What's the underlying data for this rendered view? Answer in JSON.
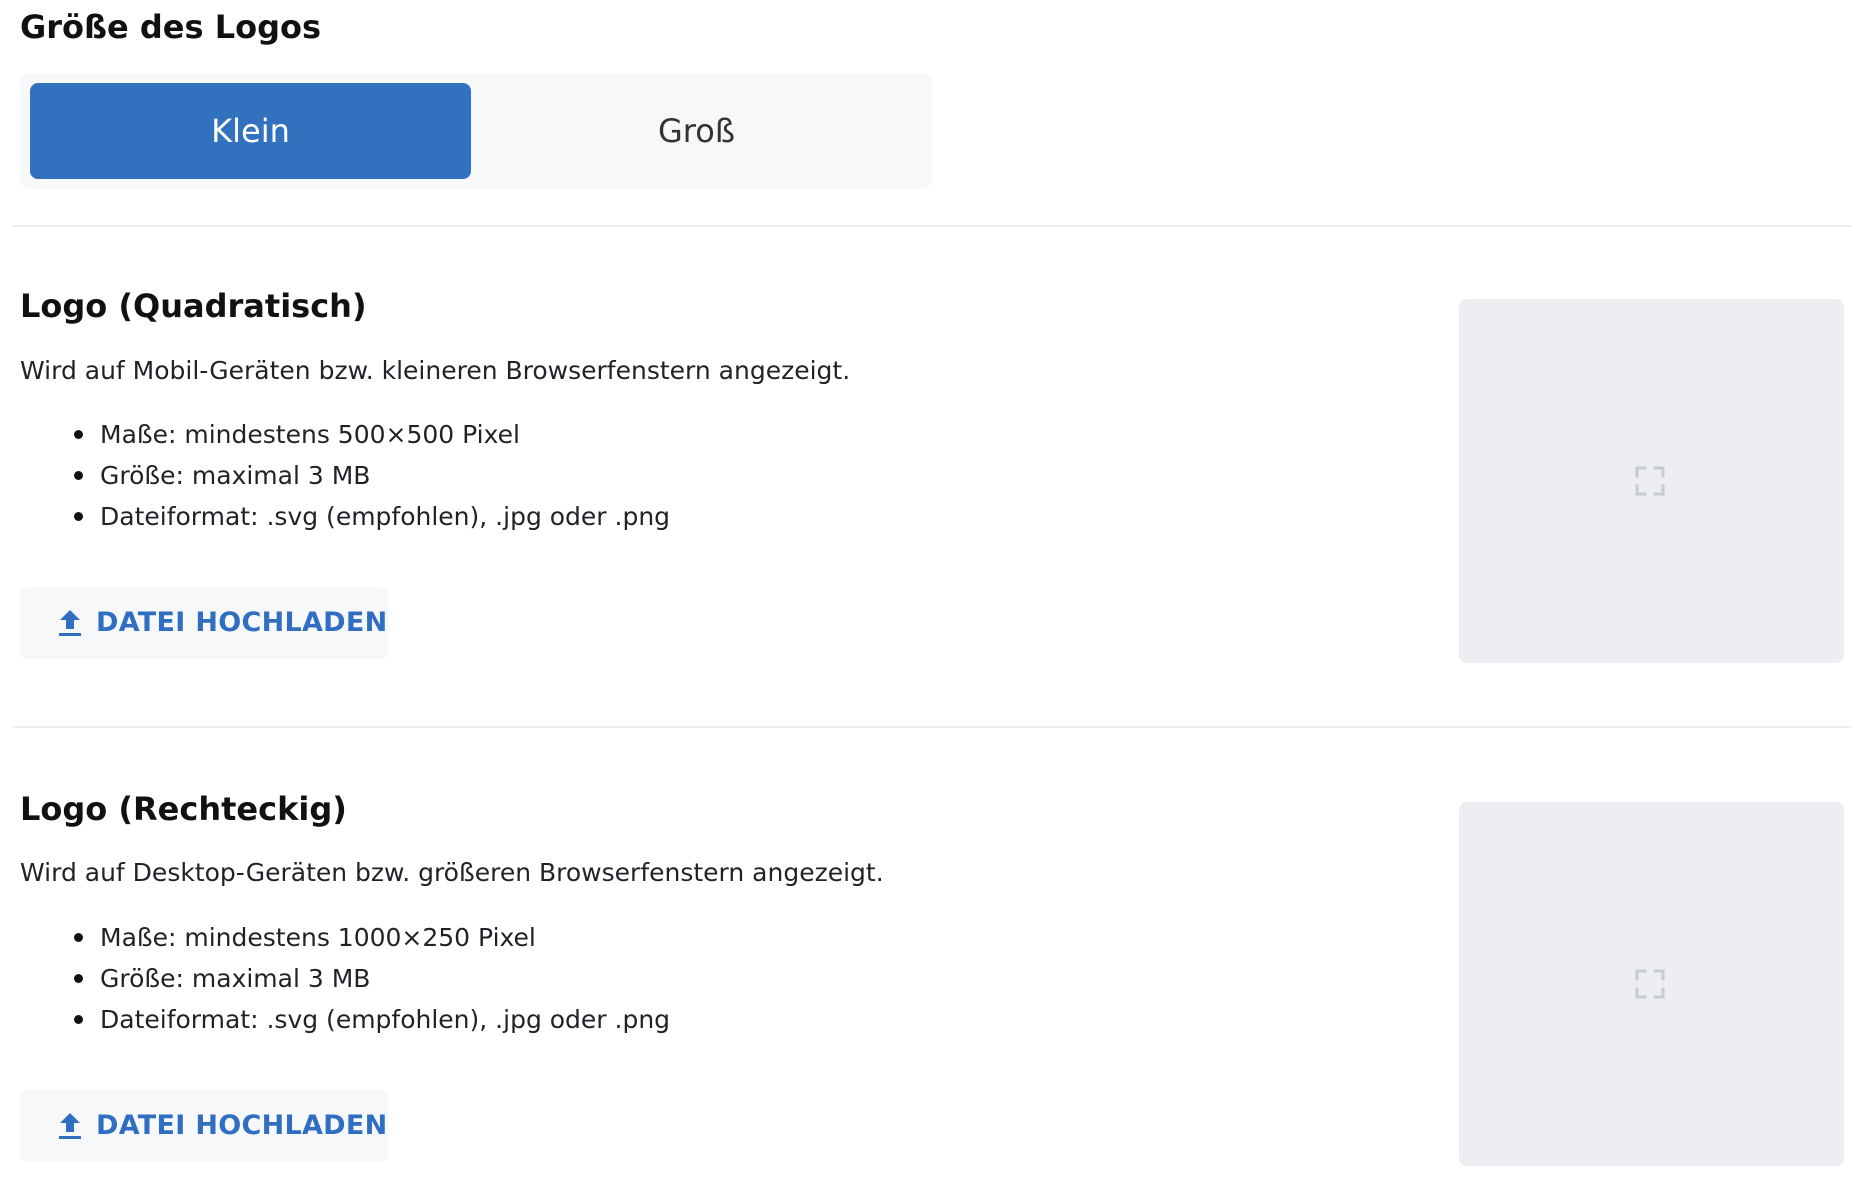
{
  "logo_size": {
    "title": "Größe des Logos",
    "options": [
      {
        "label": "Klein",
        "selected": true
      },
      {
        "label": "Groß",
        "selected": false
      }
    ]
  },
  "square_logo": {
    "title": "Logo (Quadratisch)",
    "description": "Wird auf Mobil-Geräten bzw. kleineren Browserfenstern angezeigt.",
    "specs": [
      "Maße: mindestens 500×500 Pixel",
      "Größe: maximal 3 MB",
      "Dateiformat: .svg (empfohlen), .jpg oder .png"
    ],
    "upload_button": {
      "label": "DATEI HOCHLADEN",
      "icon": "upload-icon"
    },
    "preview_icon": "fullscreen-icon"
  },
  "rectangular_logo": {
    "title": "Logo (Rechteckig)",
    "description": "Wird auf Desktop-Geräten bzw. größeren Browserfenstern angezeigt.",
    "specs": [
      "Maße: mindestens 1000×250 Pixel",
      "Größe: maximal 3 MB",
      "Dateiformat: .svg (empfohlen), .jpg oder .png"
    ],
    "upload_button": {
      "label": "DATEI HOCHLADEN",
      "icon": "upload-icon"
    },
    "preview_icon": "fullscreen-icon"
  },
  "colors": {
    "accent": "#3271be",
    "accent_text": "#2f6ec0",
    "surface": "#f7f8fa",
    "preview_background": "#eceef2"
  }
}
